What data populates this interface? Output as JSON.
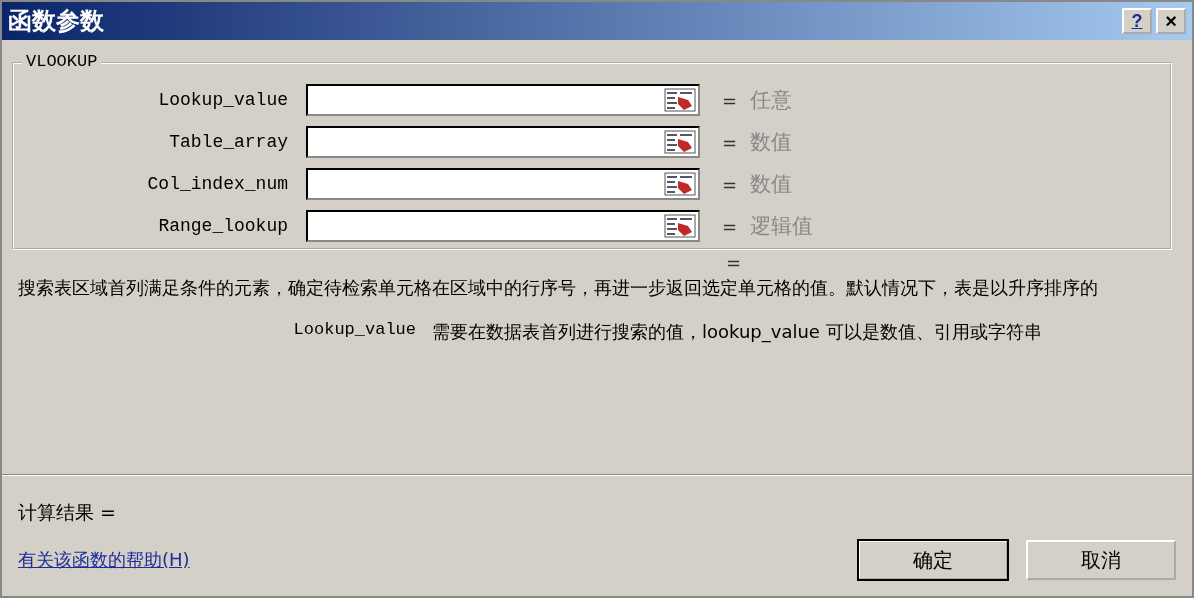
{
  "window": {
    "title": "函数参数",
    "title_buttons": [
      {
        "kind": "help",
        "label": "?"
      },
      {
        "kind": "close",
        "label": "×"
      }
    ]
  },
  "group": {
    "title": "VLOOKUP",
    "arguments": [
      {
        "label": "Lookup_value",
        "equals": "=",
        "type_hint": "任意"
      },
      {
        "label": "Table_array",
        "equals": "=",
        "type_hint": "数值"
      },
      {
        "label": "Col_index_num",
        "equals": "=",
        "type_hint": "数值"
      },
      {
        "label": "Range_lookup",
        "equals": "=",
        "type_hint": "逻辑值"
      }
    ]
  },
  "function_result": "=",
  "description": "搜索表区域首列满足条件的元素，确定待检索单元格在区域中的行序号，再进一步返回选定单元格的值。默认情况下，表是以升序排序的",
  "argument_help": {
    "name": "Lookup_value",
    "text": "需要在数据表首列进行搜索的值，lookup_value 可以是数值、引用或字符串"
  },
  "formula_result": "计算结果 =",
  "help_link": "有关该函数的帮助(H)",
  "buttons": [
    {
      "label": "确定",
      "default": true
    },
    {
      "label": "取消",
      "default": false
    }
  ]
}
